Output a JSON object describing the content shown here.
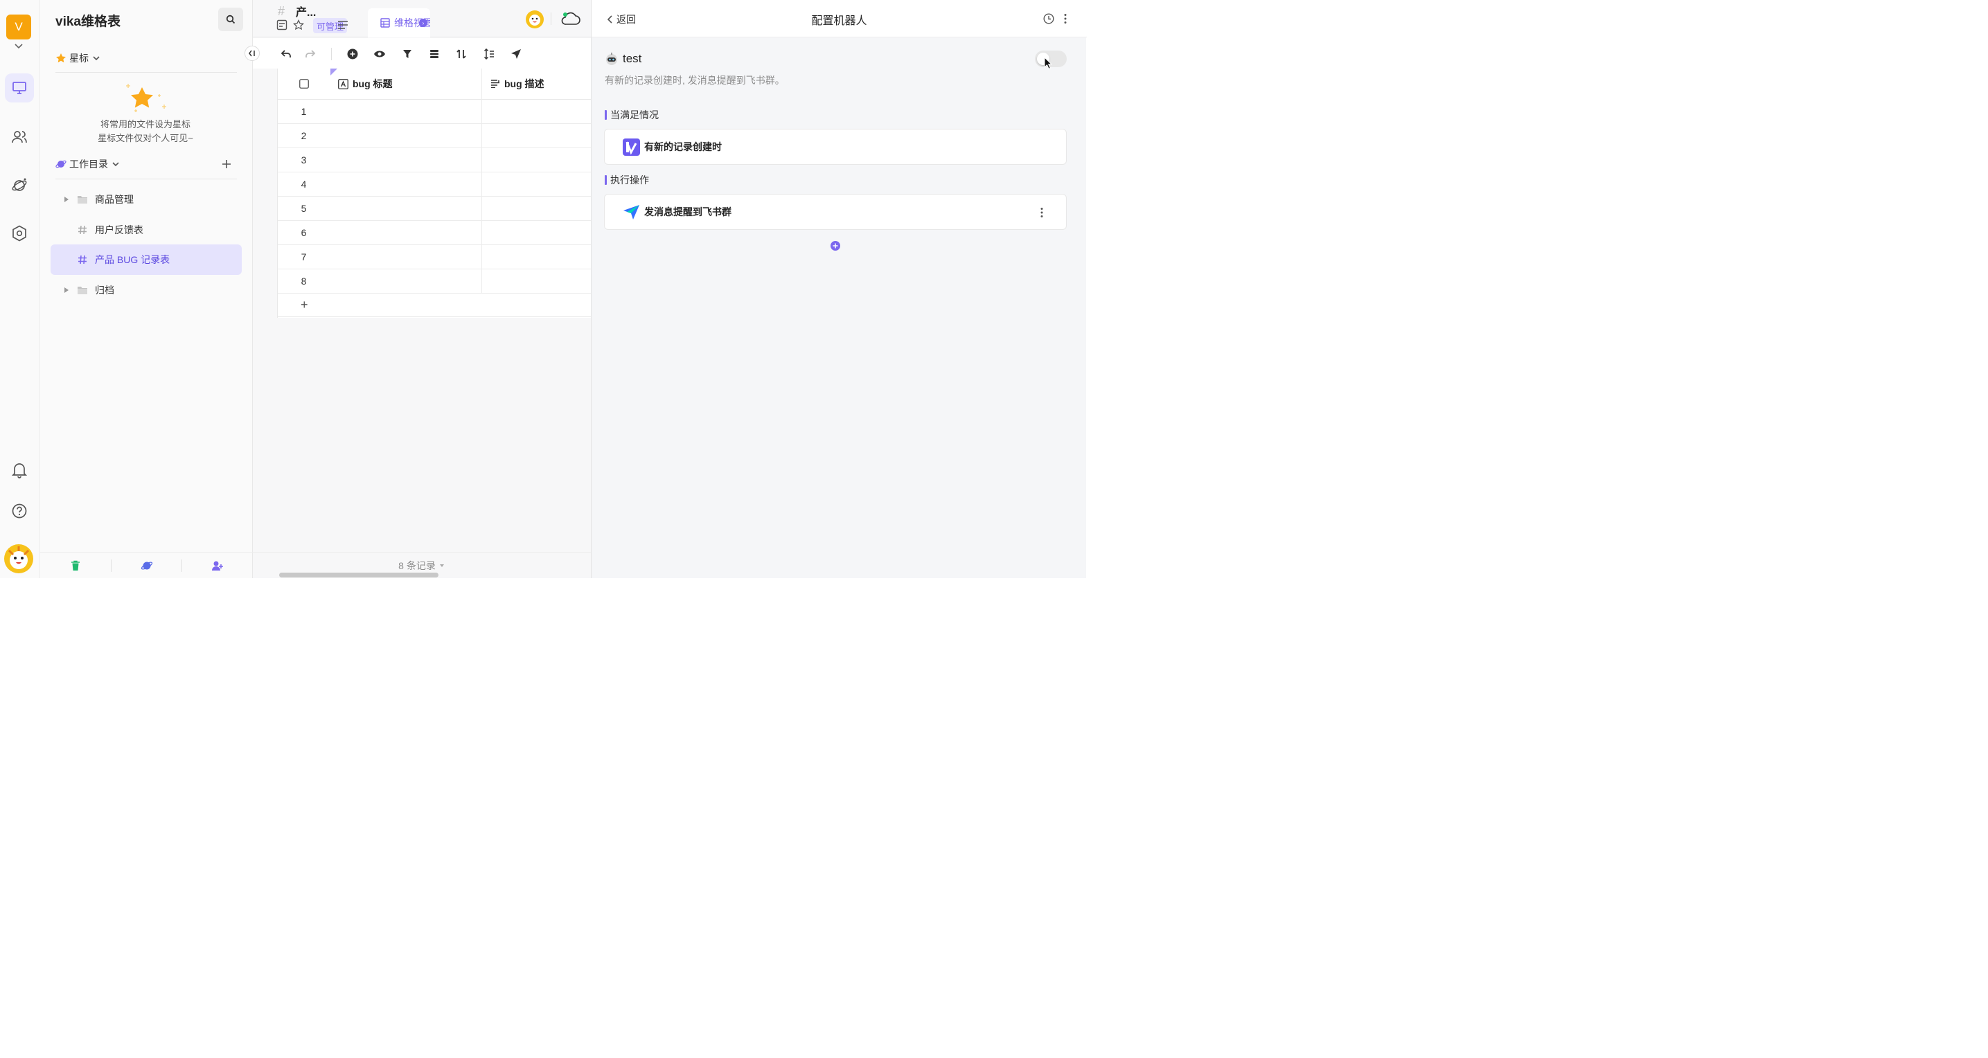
{
  "rail": {
    "space_initial": "V"
  },
  "sidebar": {
    "title": "vika维格表",
    "starred_label": "星标",
    "empty_line1": "将常用的文件设为星标",
    "empty_line2": "星标文件仅对个人可见~",
    "workspace_label": "工作目录",
    "items": [
      {
        "label": "商品管理",
        "type": "folder",
        "expandable": true
      },
      {
        "label": "用户反馈表",
        "type": "datasheet",
        "expandable": false
      },
      {
        "label": "产品 BUG 记录表",
        "type": "datasheet",
        "expandable": false,
        "active": true
      },
      {
        "label": "归档",
        "type": "folder",
        "expandable": true
      }
    ]
  },
  "sheet": {
    "tab_name": "产...",
    "permission_badge": "可管理",
    "view_name": "维格视图",
    "columns": [
      "bug 标题",
      "bug 描述"
    ],
    "rows": [
      "1",
      "2",
      "3",
      "4",
      "5",
      "6",
      "7",
      "8"
    ],
    "add_row_symbol": "+",
    "record_count": "8 条记录"
  },
  "panel": {
    "back_label": "返回",
    "title": "配置机器人",
    "robot_name": "test",
    "robot_desc": "有新的记录创建时, 发消息提醒到飞书群。",
    "enabled": false,
    "trigger_section": "当满足情况",
    "trigger": "有新的记录创建时",
    "action_section": "执行操作",
    "action": "发消息提醒到飞书群"
  },
  "colors": {
    "accent": "#7b67ee",
    "space_logo": "#f7a30b",
    "star": "#fbaa1c"
  },
  "icons": [
    "search-icon",
    "star-icon",
    "chevron-down-icon",
    "plus-icon",
    "folder-icon",
    "hash-icon",
    "trash-icon",
    "planet-icon",
    "add-user-icon",
    "undo-icon",
    "redo-icon",
    "add-circle-icon",
    "eye-icon",
    "filter-icon",
    "group-icon",
    "sort-icon",
    "row-height-icon",
    "share-icon",
    "clock-icon",
    "more-icon",
    "robot-icon",
    "feishu-icon",
    "bell-icon",
    "help-icon"
  ]
}
